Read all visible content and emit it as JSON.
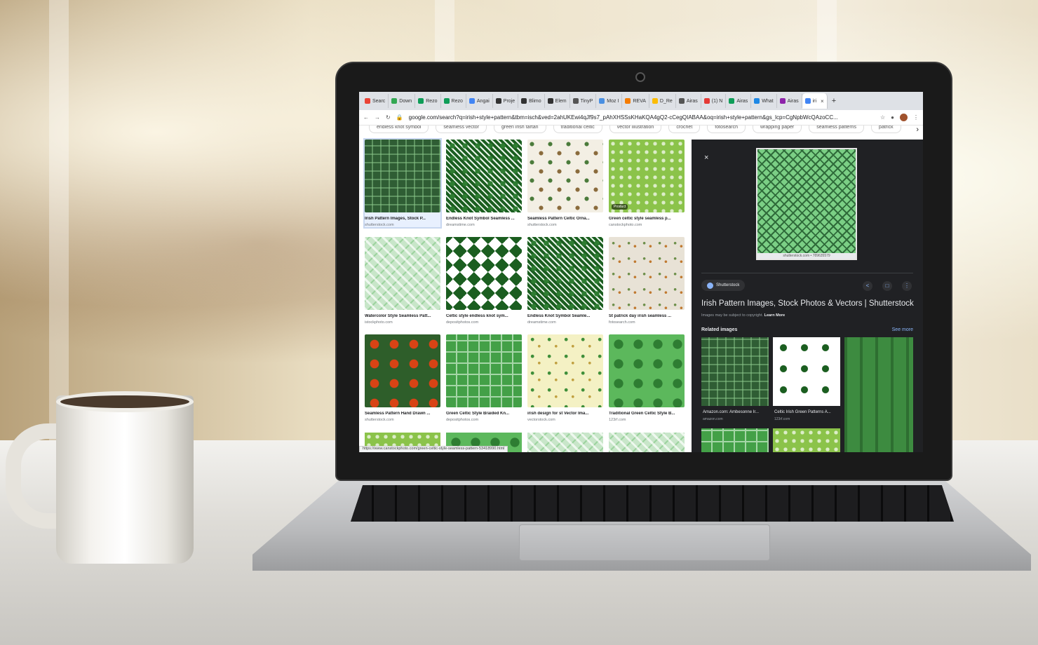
{
  "browser": {
    "tabs": [
      {
        "label": "Searc",
        "color": "#ea4335"
      },
      {
        "label": "Down",
        "color": "#34a853"
      },
      {
        "label": "Rezo",
        "color": "#0f9d58"
      },
      {
        "label": "Rezo",
        "color": "#0f9d58"
      },
      {
        "label": "Angai",
        "color": "#4285f4"
      },
      {
        "label": "Proje",
        "color": "#333333"
      },
      {
        "label": "Blimo",
        "color": "#333333"
      },
      {
        "label": "Elem",
        "color": "#333333"
      },
      {
        "label": "TinyP",
        "color": "#555555"
      },
      {
        "label": "Moz I",
        "color": "#4a90e2"
      },
      {
        "label": "REVA",
        "color": "#f57c00"
      },
      {
        "label": "D_Re",
        "color": "#fbbc05"
      },
      {
        "label": "Airas",
        "color": "#555555"
      },
      {
        "label": "(1) N",
        "color": "#e53935"
      },
      {
        "label": "Airas",
        "color": "#0f9d58"
      },
      {
        "label": "What",
        "color": "#1e88e5"
      },
      {
        "label": "Airas",
        "color": "#8e24aa"
      },
      {
        "label": "iri",
        "color": "#4285f4"
      }
    ],
    "new_tab": "+",
    "url": "google.com/search?q=irish+style+pattern&tbm=isch&ved=2ahUKEwi4qJf9s7_pAhXHSSsKHaKQA4gQ2-cCegQIABAA&oq=irish+style+pattern&gs_lcp=CgNpbWcQAzoCC..."
  },
  "chips": [
    "endless knot symbol",
    "seamless vector",
    "green irish tartan",
    "traditional celtic",
    "vector illustration",
    "crochet",
    "fotosearch",
    "wrapping paper",
    "seamless patterns",
    "patrick"
  ],
  "results": [
    {
      "title": "Irish Pattern Images, Stock P...",
      "source": "shutterstock.com",
      "pattern": "dark"
    },
    {
      "title": "Endless Knot Symbol Seamless ...",
      "source": "dreamstime.com",
      "pattern": "knot"
    },
    {
      "title": "Seamless Pattern Celtic Orna...",
      "source": "shutterstock.com",
      "pattern": "ornate"
    },
    {
      "title": "Green celtic style seamless p...",
      "source": "canstockphoto.com",
      "pattern": "braid",
      "tag": "Product"
    },
    {
      "title": "Watercolor Style Seamless Patt...",
      "source": "istockphoto.com",
      "pattern": "plaid"
    },
    {
      "title": "Celtic style endless knot sym...",
      "source": "depositphotos.com",
      "pattern": "diamond"
    },
    {
      "title": "Endless Knot Symbol Seamle...",
      "source": "dreamstime.com",
      "pattern": "knot"
    },
    {
      "title": "St patrick day irish seamless ...",
      "source": "fotosearch.com",
      "pattern": "stpat"
    },
    {
      "title": "Seamless Pattern Hand Drawn ...",
      "source": "shutterstock.com",
      "pattern": "swirl"
    },
    {
      "title": "Green Celtic Style Braided Kn...",
      "source": "depositphotos.com",
      "pattern": "greenweave"
    },
    {
      "title": "irish design for st Vector Ima...",
      "source": "vectorstock.com",
      "pattern": "shamrock"
    },
    {
      "title": "Traditional Green Celtic Style B...",
      "source": "123rf.com",
      "pattern": "trinity"
    }
  ],
  "status_url": "https://www.canstockphoto.com/green-celtic-style-seamless-pattern-53418990.html",
  "panel": {
    "close": "×",
    "preview_caption": "shutterstock.com • 789635579",
    "source_name": "Shutterstock",
    "title": "Irish Pattern Images, Stock Photos & Vectors | Shutterstock",
    "copyright": "Images may be subject to copyright.",
    "learn_more": "Learn More",
    "related_heading": "Related images",
    "see_more": "See more",
    "related": [
      {
        "title": "Amazon.com: Ambesonne Ir...",
        "source": "amazon.com"
      },
      {
        "title": "Celtic Irish Green Patterns A...",
        "source": "123rf.com"
      }
    ]
  }
}
